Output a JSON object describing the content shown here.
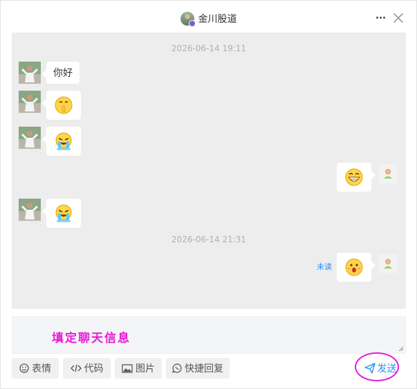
{
  "header": {
    "title": "金川股道",
    "more_icon": "more-horizontal-icon",
    "close_icon": "close-icon"
  },
  "messages": {
    "timestamp_1": "2026-06-14 19:11",
    "timestamp_2": "2026-06-14 21:31",
    "text_1": "你好",
    "emoji_1": "shush-face-emoji",
    "emoji_2": "crying-face-emoji",
    "emoji_3": "grinning-face-emoji",
    "emoji_4": "crying-face-emoji",
    "emoji_5": "surprised-face-emoji",
    "unread_label": "未读"
  },
  "composer": {
    "text": "填定聊天信息"
  },
  "toolbar": {
    "emoji_label": "表情",
    "code_label": "代码",
    "image_label": "图片",
    "quick_reply_label": "快捷回复",
    "send_label": "发送"
  },
  "colors": {
    "accent": "#2a8ff7",
    "annotation": "#e81ad6",
    "chat_background": "#ededed"
  }
}
